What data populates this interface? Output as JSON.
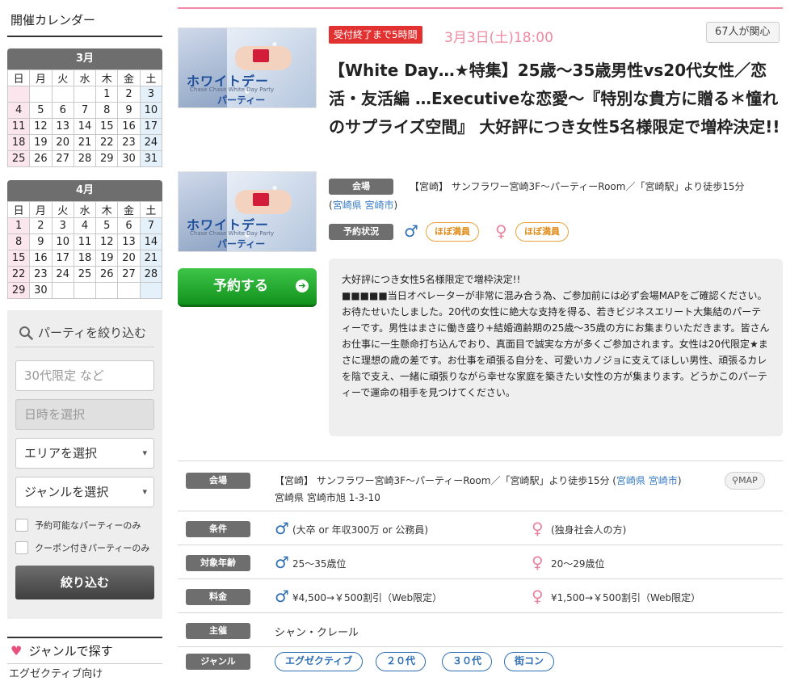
{
  "sidebar": {
    "calendar_title": "開催カレンダー",
    "weekdays": [
      "日",
      "月",
      "火",
      "水",
      "木",
      "金",
      "土"
    ],
    "months": [
      {
        "label": "3月",
        "weeks": [
          [
            "",
            "",
            "",
            "",
            "1",
            "2",
            "3"
          ],
          [
            "4",
            "5",
            "6",
            "7",
            "8",
            "9",
            "10"
          ],
          [
            "11",
            "12",
            "13",
            "14",
            "15",
            "16",
            "17"
          ],
          [
            "18",
            "19",
            "20",
            "21",
            "22",
            "23",
            "24"
          ],
          [
            "25",
            "26",
            "27",
            "28",
            "29",
            "30",
            "31"
          ]
        ]
      },
      {
        "label": "4月",
        "weeks": [
          [
            "1",
            "2",
            "3",
            "4",
            "5",
            "6",
            "7"
          ],
          [
            "8",
            "9",
            "10",
            "11",
            "12",
            "13",
            "14"
          ],
          [
            "15",
            "16",
            "17",
            "18",
            "19",
            "20",
            "21"
          ],
          [
            "22",
            "23",
            "24",
            "25",
            "26",
            "27",
            "28"
          ],
          [
            "29",
            "30",
            "",
            "",
            "",
            "",
            ""
          ]
        ]
      }
    ],
    "search": {
      "title": "パーティを絞り込む",
      "keyword_placeholder": "30代限定 など",
      "date_placeholder": "日時を選択",
      "area_select": "エリアを選択",
      "genre_select": "ジャンルを選択",
      "check_available": "予約可能なパーティーのみ",
      "check_coupon": "クーポン付きパーティーのみ",
      "submit": "絞り込む"
    },
    "genre": {
      "title": "ジャンルで探す",
      "first_item": "エグゼクティブ向け"
    }
  },
  "event": {
    "deadline_badge": "受付終了まで5時間",
    "date": "3月3日(土)18:00",
    "interest": "67人が関心",
    "title": "【White Day…★特集】25歳～35歳男性vs20代女性／恋活・友活編 …Executiveな恋愛～『特別な貴方に贈る＊憧れのサプライズ空間』 大好評につき女性5名様限定で増枠決定!!",
    "thumb_title": "ホワイトデー",
    "thumb_sub": "Chase Chase White Day Party",
    "thumb_party": "パーティー",
    "venue_label": "会場",
    "venue": "【宮崎】 サンフラワー宮崎3F～パーティーRoom／「宮崎駅」より徒歩15分",
    "venue_pref": "宮崎県",
    "venue_city": "宮崎市",
    "status_label": "予約状況",
    "male_status": "ほぼ満員",
    "female_status": "ほぼ満員",
    "reserve_button": "予約する",
    "description": [
      "大好評につき女性5名様限定で増枠決定!!",
      "■■■■■当日オペレーターが非常に混み合う為、ご参加前には必ず会場MAPをご確認ください。",
      "お待たせいたしました。20代の女性に絶大な支持を得る、若きビジネスエリート大集結のパーティーです。男性はまさに働き盛り+結婚適齢期の25歳～35歳の方にお集まりいただきます。皆さんお仕事に一生懸命打ち込んでおり、真面目で誠実な方が多くご参加されます。女性は20代限定★まさに理想の歳の差です。お仕事を頑張る自分を、可愛いカノジョに支えてほしい男性、頑張るカレを陰で支え、一緒に頑張りながら幸せな家庭を築きたい女性の方が集まります。どうかこのパーティーで運命の相手を見つけてください。"
    ]
  },
  "details": {
    "venue_label": "会場",
    "venue_text": "【宮崎】 サンフラワー宮崎3F～パーティーRoom／「宮崎駅」より徒歩15分 (",
    "venue_pref": "宮崎県",
    "venue_city": "宮崎市",
    "venue_close": ")",
    "map_button": "MAP",
    "address": "宮崎県 宮崎市旭 1-3-10",
    "condition_label": "条件",
    "condition_male": "(大卒 or 年収300万 or 公務員)",
    "condition_female": "(独身社会人の方)",
    "age_label": "対象年齢",
    "age_male": "25～35歳位",
    "age_female": "20～29歳位",
    "fee_label": "料金",
    "fee_male": "¥4,500→￥500割引（Web限定）",
    "fee_female": "¥1,500→￥500割引（Web限定）",
    "host_label": "主催",
    "host": "シャン・クレール",
    "genre_label": "ジャンル",
    "genre_tags": [
      "エグゼクティブ",
      "２０代",
      "３０代",
      "街コン"
    ]
  },
  "colors": {
    "accent_pink": "#ef8aa2",
    "link_blue": "#3b7ec4",
    "reserve_green": "#13951f",
    "status_orange": "#e08b1a",
    "badge_red": "#e23131"
  }
}
